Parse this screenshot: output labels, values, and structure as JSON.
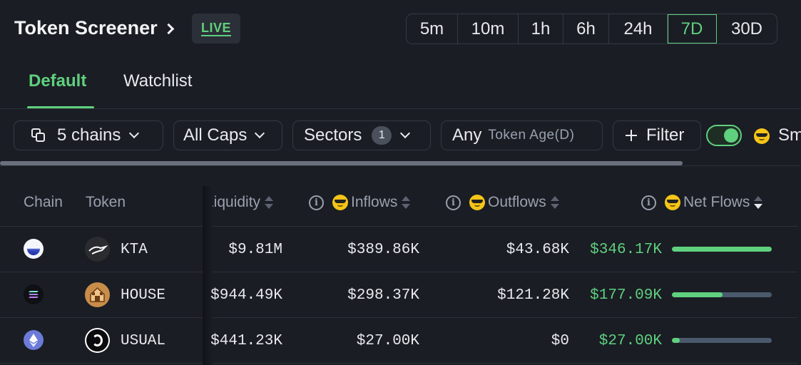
{
  "header": {
    "title": "Token Screener",
    "live_label": "LIVE",
    "timeframes": [
      "5m",
      "10m",
      "1h",
      "6h",
      "24h",
      "7D",
      "30D"
    ],
    "active_timeframe": "7D"
  },
  "tabs": [
    "Default",
    "Watchlist"
  ],
  "active_tab": "Default",
  "filters": {
    "chains_label": "5 chains",
    "caps_label": "All Caps",
    "sectors_label": "Sectors",
    "sectors_count": "1",
    "age_value": "Any",
    "age_placeholder": "Token Age(D)",
    "filter_label": "Filter",
    "smart_toggle_on": true,
    "smart_label_partial": "Sm"
  },
  "table": {
    "headers": {
      "chain": "Chain",
      "token": "Token",
      "liquidity": "Liquidity",
      "inflows": "Inflows",
      "outflows": "Outflows",
      "net_flows": "Net Flows"
    },
    "rows": [
      {
        "chain": "solana-variant",
        "token": "KTA",
        "liquidity": "$9.81M",
        "inflows": "$389.86K",
        "outflows": "$43.68K",
        "net_flows": "$346.17K",
        "net_ratio": 1.0
      },
      {
        "chain": "solana",
        "token": "HOUSE",
        "liquidity": "$944.49K",
        "inflows": "$298.37K",
        "outflows": "$121.28K",
        "net_flows": "$177.09K",
        "net_ratio": 0.51
      },
      {
        "chain": "ethereum",
        "token": "USUAL",
        "liquidity": "$441.23K",
        "inflows": "$27.00K",
        "outflows": "$0",
        "net_flows": "$27.00K",
        "net_ratio": 0.08
      }
    ]
  },
  "colors": {
    "accent": "#5fd07e",
    "background": "#1a1d24",
    "border": "#343943",
    "bar_track": "#4a5a6c"
  }
}
